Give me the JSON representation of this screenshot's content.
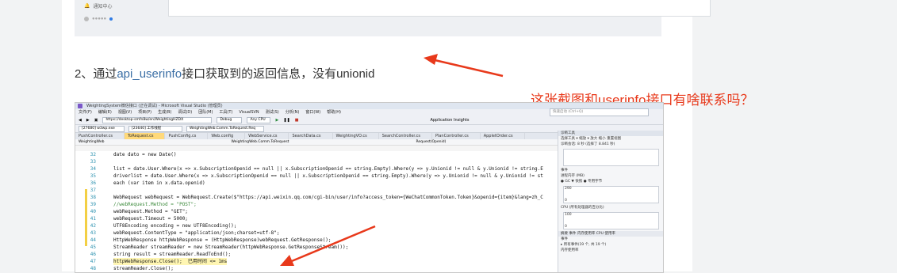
{
  "top_screenshot": {
    "sidebar_item_1": "通知中心",
    "sidebar_item_2": "●●●●●"
  },
  "heading": {
    "prefix": "2、通过",
    "link": "api_userinfo",
    "suffix": "接口获取到的返回信息，没有unionid"
  },
  "annotation": {
    "text": "这张截图和userinfo接口有啥联系吗？",
    "color": "#e8391b"
  },
  "vs": {
    "title": "WeightingSystem微信接口 (正在调试) - Microsoft Visual Studio (管理员)",
    "menu": [
      "文件(F)",
      "编辑(E)",
      "视图(V)",
      "项目(P)",
      "生成(B)",
      "调试(D)",
      "团队(M)",
      "工具(T)",
      "VisualSVN",
      "测试(S)",
      "分析(N)",
      "窗口(W)",
      "帮助(H)"
    ],
    "url_field": "https://desktop-smfn8w/en/WeightingHZDX",
    "debug_field": "Debug",
    "cpu_field": "Any CPU",
    "process_field": "[27680] w3wp.exe",
    "thread_field": "[23640] 工作线程",
    "stack_field": "WeightingWeb.Comm.ToRequest.Req",
    "app_insights": "Application Insights",
    "search_placeholder": "快速启动 (Ctrl+Q)",
    "tabs": [
      "PushController.cs",
      "ToRequest.cs",
      "PushConfig.cs",
      "Web.config",
      "WebService.cs",
      "SearchData.cs",
      "WeightingVO.cs",
      "SearchController.cs",
      "PlanController.cs",
      "AppletOrder.cs"
    ],
    "active_tab": 1,
    "nav": [
      "WeightingWeb",
      "WeightingWeb.Comm.ToRequest",
      "Request(Openid)"
    ],
    "lines": [
      {
        "n": "32",
        "code": "date dato = new Date()",
        "cls": ""
      },
      {
        "n": "33",
        "code": "",
        "cls": ""
      },
      {
        "n": "34",
        "code": "list = date.User.Where(x => x.SubscriptionOpenid == null || x.SubscriptionOpenid == string.Empty).Where(y => y.Unionid != null & y.Unionid != string.E",
        "cls": ""
      },
      {
        "n": "35",
        "code": "driverlist = date.User.Where(x => x.SubscriptionOpenid == null || x.SubscriptionOpenid == string.Empty).Where(y => y.Unionid != null & y.Unionid != st",
        "cls": ""
      },
      {
        "n": "36",
        "code": "each (var item in x.data.openid)",
        "cls": ""
      },
      {
        "n": "37",
        "code": "",
        "cls": ""
      },
      {
        "n": "38",
        "code": "WebRequest webRequest = WebRequest.Create($\"https://api.weixin.qq.com/cgi-bin/user/info?access_token={WeChatCommonToken.Token}&openid={item}&lang=zh_C",
        "cls": ""
      },
      {
        "n": "39",
        "code": "//webRequest.Method = \"POST\";",
        "cls": "green"
      },
      {
        "n": "40",
        "code": "webRequest.Method = \"GET\";",
        "cls": ""
      },
      {
        "n": "41",
        "code": "webRequest.Timeout = 5000;",
        "cls": ""
      },
      {
        "n": "42",
        "code": "UTF8Encoding encoding = new UTF8Encoding();",
        "cls": ""
      },
      {
        "n": "43",
        "code": "webRequest.ContentType = \"application/json;charset=utf-8\";",
        "cls": ""
      },
      {
        "n": "44",
        "code": "HttpWebResponse httpWebResponse = (HttpWebResponse)webRequest.GetResponse();",
        "cls": ""
      },
      {
        "n": "45",
        "code": "StreamReader streamReader = new StreamReader(httpWebResponse.GetResponseStream());",
        "cls": ""
      },
      {
        "n": "46",
        "code": "string result = streamReader.ReadToEnd();",
        "cls": ""
      },
      {
        "n": "47",
        "code": "httpWebResponse.Close();  已用时间 <= 1ms",
        "cls": "hl"
      },
      {
        "n": "48",
        "code": "streamReader.Close();",
        "cls": ""
      }
    ],
    "diag": {
      "header": "诊断工具",
      "toolbar": "选择工具 ▾   缩放  ▾  放大  缩小  重置视图",
      "session": "诊断会话: 8 秒 (选择了 8.841 秒)",
      "events": "事件",
      "memory": "进程内存 (MB)",
      "memory_legend": "● GC  ▼ 快照  ● 专用字节",
      "mem_max": "290",
      "mem_min": "0",
      "cpu": "CPU (所有处理器的百分比)",
      "cpu_max": "100",
      "cpu_min": "0",
      "tabs": "摘要  事件  内存使用率  CPU 使用率",
      "events_row": "事件",
      "events_detail": "▸ 所有事件(19 个, 共 19 个)",
      "memory_row": "内存使用率"
    }
  }
}
